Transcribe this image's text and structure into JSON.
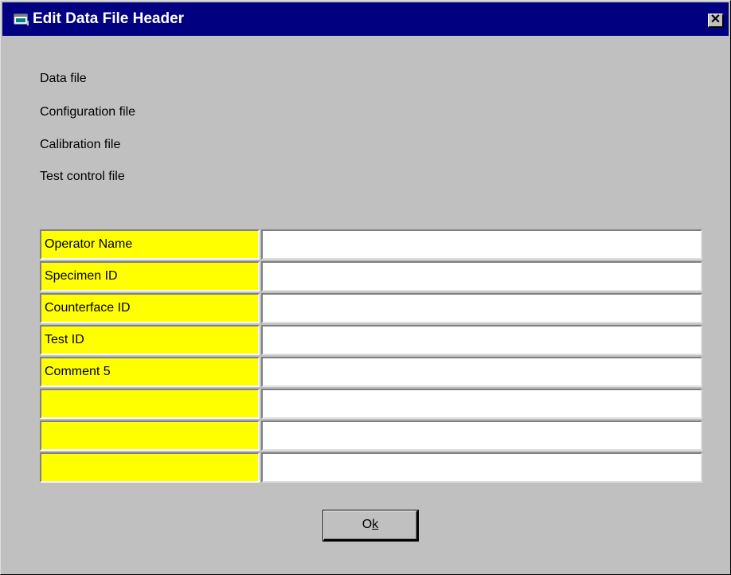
{
  "window": {
    "title": "Edit Data File Header",
    "close_label": "✕"
  },
  "info": {
    "data_file_label": "Data file",
    "configuration_file_label": "Configuration file",
    "calibration_file_label": "Calibration file",
    "test_control_file_label": "Test control file"
  },
  "header_fields": [
    {
      "label": "Operator Name",
      "value": ""
    },
    {
      "label": "Specimen ID",
      "value": ""
    },
    {
      "label": "Counterface ID",
      "value": ""
    },
    {
      "label": "Test ID",
      "value": ""
    },
    {
      "label": "Comment 5",
      "value": ""
    },
    {
      "label": "",
      "value": ""
    },
    {
      "label": "",
      "value": ""
    },
    {
      "label": "",
      "value": ""
    }
  ],
  "buttons": {
    "ok_prefix": "O",
    "ok_mnemonic": "k"
  },
  "colors": {
    "title_bar": "#000080",
    "dialog_face": "#c0c0c0",
    "label_cell": "#ffff00",
    "value_cell": "#ffffff"
  },
  "icons": {
    "app": "app-window-icon",
    "close": "close-icon"
  }
}
